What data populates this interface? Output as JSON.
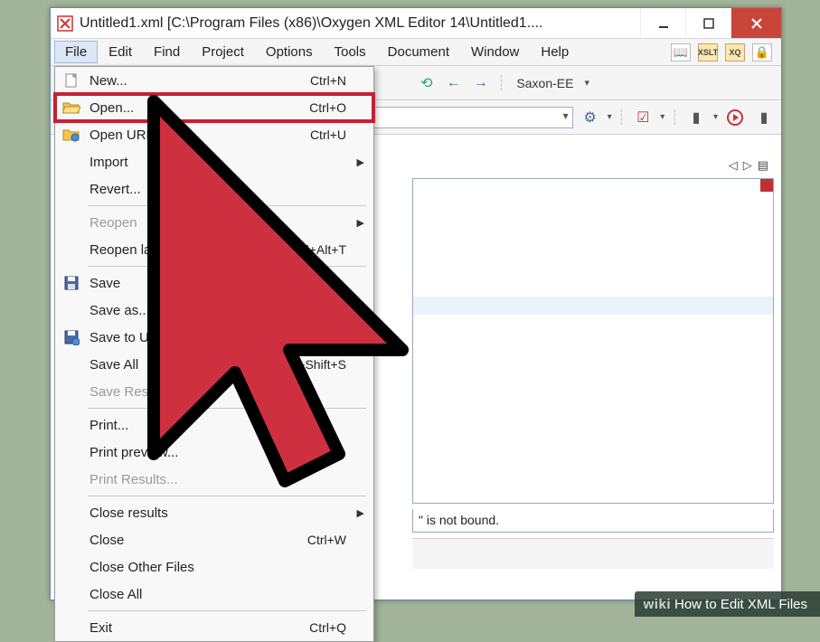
{
  "window": {
    "title": "Untitled1.xml [C:\\Program Files (x86)\\Oxygen XML Editor 14\\Untitled1...."
  },
  "menubar": {
    "items": [
      "File",
      "Edit",
      "Find",
      "Project",
      "Options",
      "Tools",
      "Document",
      "Window",
      "Help"
    ]
  },
  "toolbar1": {
    "processor": "Saxon-EE"
  },
  "dropdown": {
    "items": [
      {
        "icon": "new-icon",
        "label": "New...",
        "accel": "Ctrl+N",
        "kind": "item"
      },
      {
        "icon": "open-icon",
        "label": "Open...",
        "accel": "Ctrl+O",
        "kind": "item",
        "highlight": true
      },
      {
        "icon": "open-url-icon",
        "label": "Open URL...",
        "accel": "Ctrl+U",
        "kind": "item"
      },
      {
        "icon": "",
        "label": "Import",
        "accel": "",
        "kind": "submenu"
      },
      {
        "icon": "",
        "label": "Revert...",
        "accel": "",
        "kind": "item"
      },
      {
        "kind": "sep"
      },
      {
        "icon": "",
        "label": "Reopen",
        "accel": "",
        "kind": "submenu",
        "disabled": true
      },
      {
        "icon": "",
        "label": "Reopen last closed editor",
        "accel": "Ctrl+Alt+T",
        "kind": "item"
      },
      {
        "kind": "sep"
      },
      {
        "icon": "save-icon",
        "label": "Save",
        "accel": "",
        "kind": "item"
      },
      {
        "icon": "",
        "label": "Save as...",
        "accel": "",
        "kind": "item"
      },
      {
        "icon": "save-url-icon",
        "label": "Save to URL...",
        "accel": "",
        "kind": "item"
      },
      {
        "icon": "",
        "label": "Save All",
        "accel": "Ctrl+Shift+S",
        "kind": "item"
      },
      {
        "icon": "",
        "label": "Save Results...",
        "accel": "",
        "kind": "item",
        "disabled": true
      },
      {
        "kind": "sep"
      },
      {
        "icon": "",
        "label": "Print...",
        "accel": "",
        "kind": "item"
      },
      {
        "icon": "",
        "label": "Print preview...",
        "accel": "",
        "kind": "item"
      },
      {
        "icon": "",
        "label": "Print Results...",
        "accel": "",
        "kind": "item",
        "disabled": true
      },
      {
        "kind": "sep"
      },
      {
        "icon": "",
        "label": "Close results",
        "accel": "",
        "kind": "submenu"
      },
      {
        "icon": "",
        "label": "Close",
        "accel": "Ctrl+W",
        "kind": "item"
      },
      {
        "icon": "",
        "label": "Close Other Files",
        "accel": "",
        "kind": "item"
      },
      {
        "icon": "",
        "label": "Close All",
        "accel": "",
        "kind": "item"
      },
      {
        "kind": "sep"
      },
      {
        "icon": "",
        "label": "Exit",
        "accel": "Ctrl+Q",
        "kind": "item"
      }
    ]
  },
  "status": {
    "msg": "\" is not bound."
  },
  "caption": {
    "wiki": "wiki",
    "text": "How to Edit XML Files"
  }
}
